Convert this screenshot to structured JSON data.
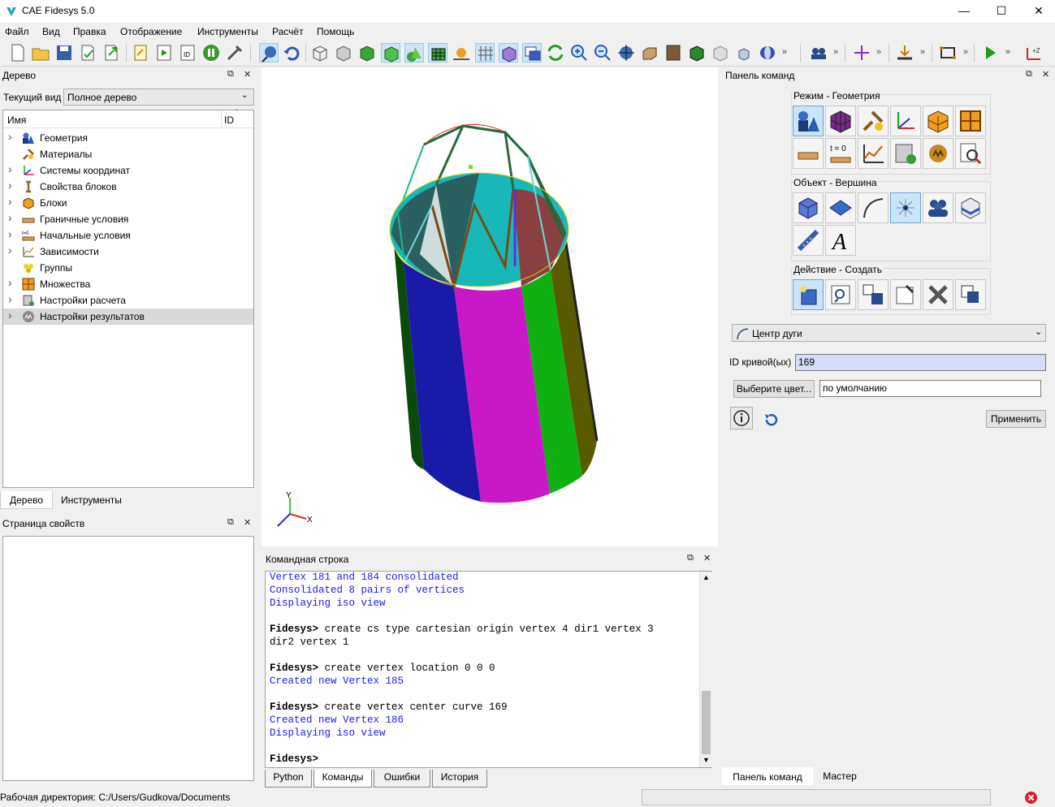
{
  "window": {
    "title": "CAE Fidesys 5.0",
    "min": "—",
    "max": "☐",
    "close": "✕"
  },
  "menu": [
    "Файл",
    "Вид",
    "Правка",
    "Отображение",
    "Инструменты",
    "Расчёт",
    "Помощь"
  ],
  "toolbar": {
    "overflow": "»"
  },
  "tree_dock": {
    "title": "Дерево",
    "current_view_label": "Текущий вид",
    "current_view_value": "Полное дерево",
    "col_name": "Имя",
    "col_id": "ID",
    "items": [
      {
        "label": "Геометрия",
        "icon": "geometry-icon",
        "expandable": true
      },
      {
        "label": "Материалы",
        "icon": "materials-icon",
        "expandable": false
      },
      {
        "label": "Системы координат",
        "icon": "coordinate-systems-icon",
        "expandable": true
      },
      {
        "label": "Свойства блоков",
        "icon": "block-properties-icon",
        "expandable": true
      },
      {
        "label": "Блоки",
        "icon": "blocks-icon",
        "expandable": true
      },
      {
        "label": "Граничные условия",
        "icon": "boundary-conditions-icon",
        "expandable": true
      },
      {
        "label": "Начальные условия",
        "icon": "initial-conditions-icon",
        "expandable": true
      },
      {
        "label": "Зависимости",
        "icon": "dependencies-icon",
        "expandable": true
      },
      {
        "label": "Группы",
        "icon": "groups-icon",
        "expandable": false
      },
      {
        "label": "Множества",
        "icon": "sets-icon",
        "expandable": true
      },
      {
        "label": "Настройки расчета",
        "icon": "analysis-settings-icon",
        "expandable": true
      },
      {
        "label": "Настройки результатов",
        "icon": "results-settings-icon",
        "expandable": true
      }
    ],
    "tabs": [
      "Дерево",
      "Инструменты"
    ]
  },
  "properties_dock": {
    "title": "Страница свойств"
  },
  "viewport": {
    "axis_x": "X",
    "axis_y": "Y"
  },
  "console_dock": {
    "title": "Командная строка",
    "lines": [
      {
        "type": "out",
        "text": "Vertex 181 and 184 consolidated"
      },
      {
        "type": "out",
        "text": "Consolidated 8 pairs of vertices"
      },
      {
        "type": "out",
        "text": "Displaying iso view"
      },
      {
        "type": "blank",
        "text": ""
      },
      {
        "type": "cmd",
        "prompt": "Fidesys>",
        "text": " create cs type cartesian origin vertex 4 dir1 vertex 3"
      },
      {
        "type": "cont",
        "text": "dir2 vertex 1"
      },
      {
        "type": "blank",
        "text": ""
      },
      {
        "type": "cmd",
        "prompt": "Fidesys>",
        "text": " create vertex location 0 0 0"
      },
      {
        "type": "out",
        "text": "Created new Vertex 185"
      },
      {
        "type": "blank",
        "text": ""
      },
      {
        "type": "cmd",
        "prompt": "Fidesys>",
        "text": " create vertex center curve 169"
      },
      {
        "type": "out",
        "text": "Created new Vertex 186"
      },
      {
        "type": "out",
        "text": "Displaying iso view"
      },
      {
        "type": "blank",
        "text": ""
      },
      {
        "type": "cmd",
        "prompt": "Fidesys>",
        "text": ""
      }
    ],
    "tabs": [
      "Python",
      "Команды",
      "Ошибки",
      "История"
    ]
  },
  "command_panel": {
    "title": "Панель команд",
    "mode_label": "Режим - Геометрия",
    "object_label": "Объект - Вершина",
    "action_label": "Действие - Создать",
    "t0_label": "t = 0",
    "method_select": "Центр дуги",
    "curve_id_label": "ID кривой(ых)",
    "curve_id_value": "169",
    "color_button": "Выберите цвет...",
    "color_value": "по умолчанию",
    "apply_button": "Применить",
    "tabs": [
      "Панель команд",
      "Мастер"
    ]
  },
  "status": {
    "workdir": "Рабочая директория: C:/Users/Gudkova/Documents"
  }
}
